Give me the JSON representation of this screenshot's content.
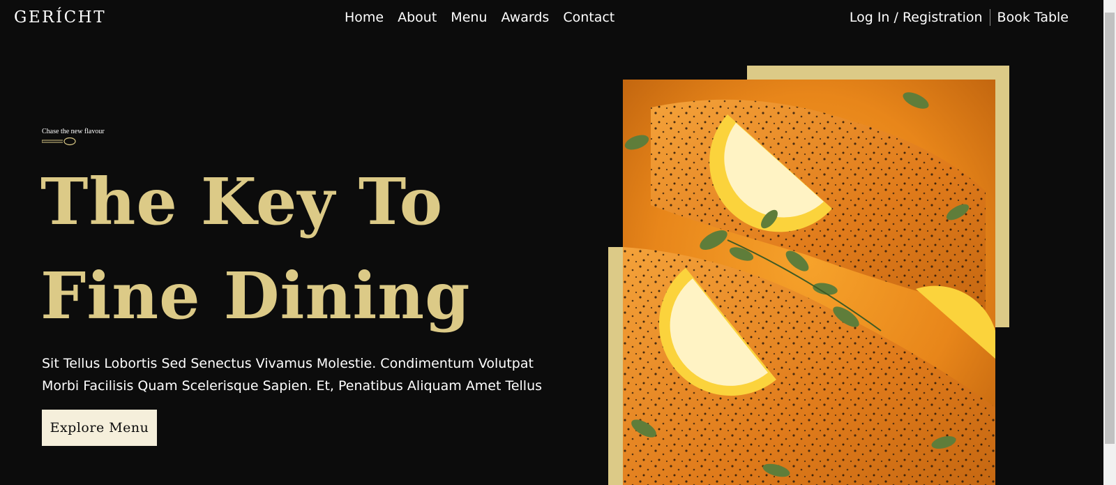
{
  "navbar": {
    "logo": "GERÍCHT",
    "links": [
      "Home",
      "About",
      "Menu",
      "Awards",
      "Contact"
    ],
    "login_label": "Log In / Registration",
    "book_label": "Book Table"
  },
  "hero": {
    "subtitle": "Chase the new flavour",
    "headline_line1": "The Key To",
    "headline_line2": "Fine Dining",
    "description": "Sit Tellus Lobortis Sed Senectus Vivamus Molestie. Condimentum Volutpat Morbi Facilisis Quam Scelerisque Sapien. Et, Penatibus Aliquam Amet Tellus",
    "button_label": "Explore Menu"
  },
  "image": {
    "icon": "food-photo"
  },
  "colors": {
    "background": "#0c0c0c",
    "accent_gold": "#dcca87",
    "button_bg": "#f5efdb",
    "text": "#ffffff"
  }
}
